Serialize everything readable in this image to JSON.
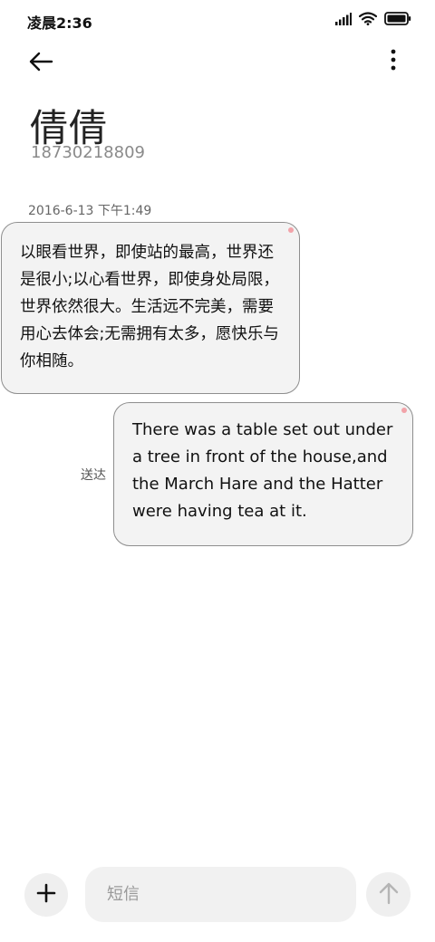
{
  "status_bar": {
    "time": "凌晨2:36",
    "icons": [
      "signal-icon",
      "wifi-icon",
      "battery-icon"
    ]
  },
  "top_bar": {
    "back_icon": "arrow-left-icon",
    "more_icon": "more-vertical-icon"
  },
  "contact": {
    "name": "倩倩",
    "phone": "18730218809"
  },
  "conversation": {
    "date": "2016-6-13 下午1:49",
    "messages": [
      {
        "direction": "incoming",
        "text": "以眼看世界，即使站的最高，世界还是很小;以心看世界，即使身处局限，世界依然很大。生活远不完美，需要用心去体会;无需拥有太多，愿快乐与你相随。"
      },
      {
        "direction": "outgoing",
        "text": "There was a table set out under a tree in front of the house,and the March Hare and the Hatter were having tea at it.",
        "status": "送达"
      }
    ]
  },
  "composer": {
    "add_icon": "plus-icon",
    "placeholder": "短信",
    "value": "",
    "send_icon": "arrow-up-icon"
  },
  "colors": {
    "bubble_bg": "#f3f3f3",
    "bubble_border": "#8e8e8e",
    "unread_dot": "#f2a3a9",
    "send_disabled": "#b5b5b5"
  }
}
